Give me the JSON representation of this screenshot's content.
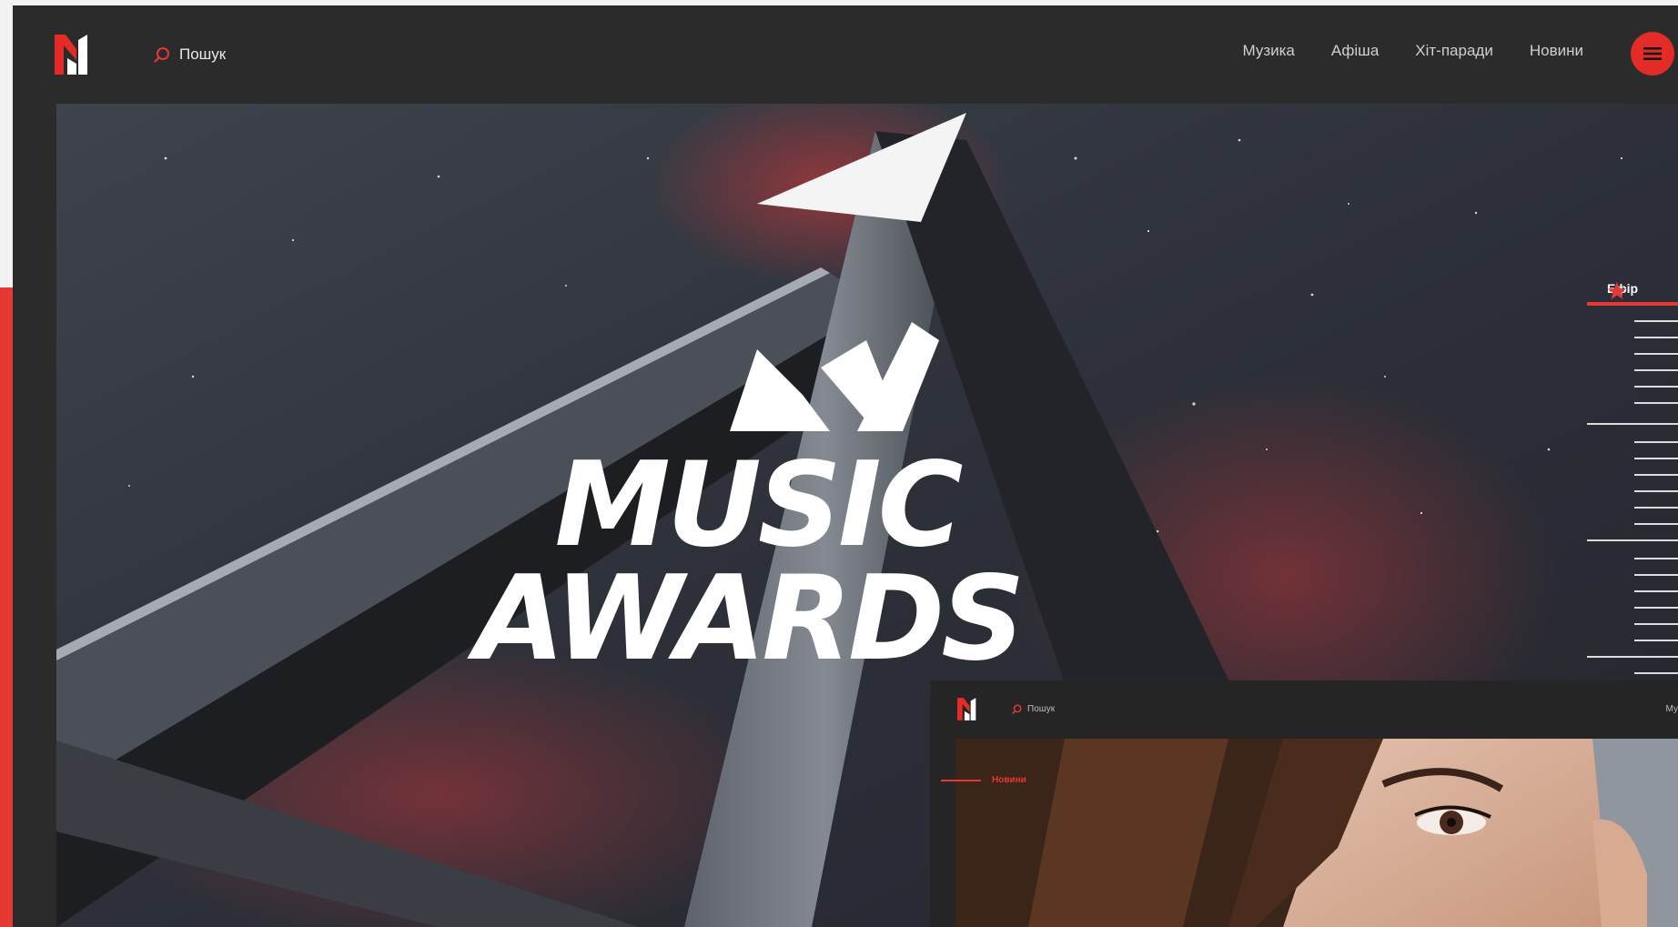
{
  "brand": {
    "logo_text": "M1",
    "accent": "#e32b27"
  },
  "header": {
    "search_label": "Пошук",
    "nav": [
      "Музика",
      "Афіша",
      "Хіт-паради",
      "Новини"
    ]
  },
  "hero": {
    "line1": "MUSIC",
    "line2": "AWARDS"
  },
  "ticker": {
    "label": "Ефір"
  },
  "nested": {
    "search_label": "Пошук",
    "nav_partial": "Му",
    "section_label": "Новини"
  },
  "icons": {
    "search": "search-icon",
    "menu": "hamburger-menu-icon",
    "star": "star-icon"
  }
}
